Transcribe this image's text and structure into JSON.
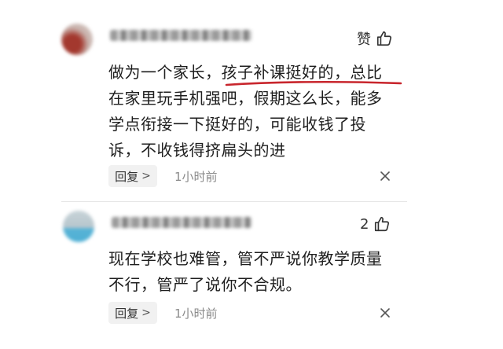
{
  "comments": [
    {
      "like_label": "赞",
      "text_lines": [
        "做为一个家长，孩子补课挺好的，总比",
        "在家里玩手机强吧，假期这么长，能多",
        "学点衔接一下挺好的，可能收钱了投",
        "诉，不收钱得挤扁头的进"
      ],
      "reply_label": "回复",
      "reply_chevron": ">",
      "time": "1小时前",
      "underline_color": "#c8262d"
    },
    {
      "like_label": "2",
      "text_lines": [
        "现在学校也难管，管不严说你教学质量",
        "不行，管严了说你不合规。"
      ],
      "reply_label": "回复",
      "reply_chevron": ">",
      "time": "1小时前"
    }
  ],
  "icons": {
    "like": "thumbs-up-icon",
    "close": "close-icon"
  }
}
